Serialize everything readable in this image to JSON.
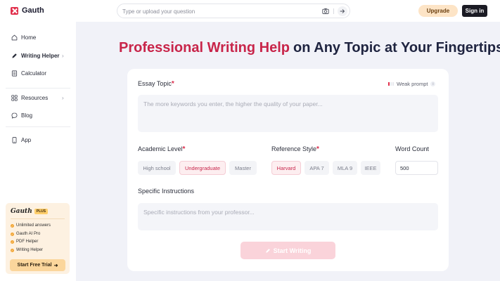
{
  "app": {
    "name": "Gauth",
    "colors": {
      "brand": "#e1304c",
      "accent": "#c8254a",
      "upgrade_bg": "#fde4c6"
    }
  },
  "header": {
    "search_placeholder": "Type or upload your question",
    "upgrade_label": "Upgrade",
    "signin_label": "Sign in",
    "icons": [
      "camera-icon",
      "arrow-right-icon"
    ]
  },
  "sidebar": {
    "items": [
      {
        "label": "Home",
        "icon": "home-icon"
      },
      {
        "label": "Writing Helper",
        "icon": "pen-icon",
        "active": true,
        "chevron": "›"
      },
      {
        "label": "Calculator",
        "icon": "calculator-icon"
      },
      {
        "label": "Resources",
        "icon": "grid-icon",
        "chevron": "›"
      },
      {
        "label": "Blog",
        "icon": "chat-icon"
      },
      {
        "label": "App",
        "icon": "phone-icon"
      }
    ],
    "plus": {
      "brand": "Gauth",
      "badge": "PLUS",
      "features": [
        "Unlimited answers",
        "Gauth AI Pro",
        "PDF Helper",
        "Writing Helper"
      ],
      "cta": "Start Free Trial",
      "cta_arrow": "➜"
    }
  },
  "main": {
    "heading_highlight": "Professional Writing Help",
    "heading_rest": "on Any Topic at Your Fingertips",
    "form": {
      "essay_topic_label": "Essay Topic",
      "required_mark": "*",
      "prompt_strength": "Weak prompt",
      "info_mark": "i",
      "essay_topic_placeholder": "The more keywords you enter, the higher the quality of your paper...",
      "academic_level_label": "Academic Level",
      "academic_levels": [
        "High school",
        "Undergraduate",
        "Master"
      ],
      "academic_level_selected": "Undergraduate",
      "reference_style_label": "Reference Style",
      "reference_styles": [
        "Harvard",
        "APA 7",
        "MLA 9",
        "IEEE"
      ],
      "reference_style_selected": "Harvard",
      "word_count_label": "Word Count",
      "word_count_value": "500",
      "specific_instructions_label": "Specific Instructions",
      "specific_instructions_placeholder": "Specific instructions from your professor...",
      "start_button": "Start Writing"
    }
  }
}
